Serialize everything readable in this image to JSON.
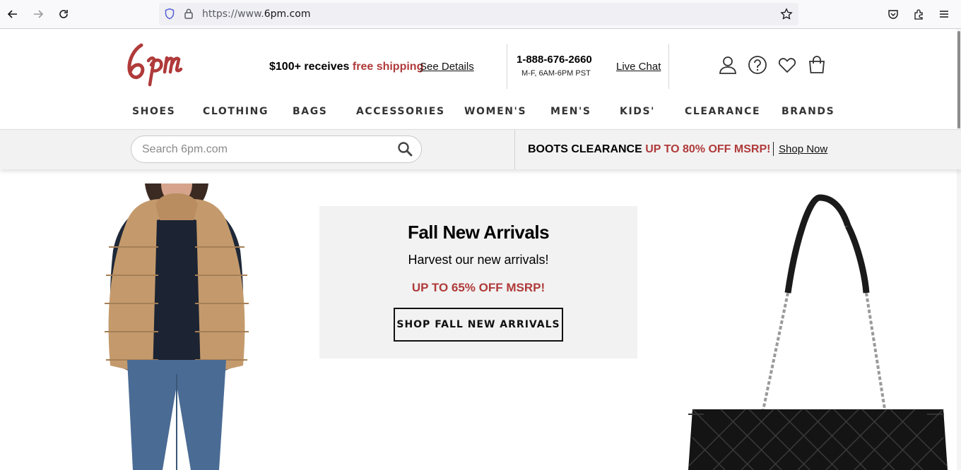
{
  "browser": {
    "url_prefix": "https://www.",
    "url_domain": "6pm.com"
  },
  "header": {
    "logo_text": "6pm",
    "shipping_prefix": "$100+ receives ",
    "shipping_highlight": "free shipping",
    "see_details": "See Details",
    "phone": "1-888-676-2660",
    "hours": "M-F, 6AM-6PM PST",
    "live_chat": "Live Chat"
  },
  "nav": {
    "items": [
      "SHOES",
      "CLOTHING",
      "BAGS",
      "ACCESSORIES",
      "WOMEN'S",
      "MEN'S",
      "KIDS'",
      "CLEARANCE",
      "BRANDS"
    ]
  },
  "search": {
    "placeholder": "Search 6pm.com"
  },
  "banner": {
    "boots_label": "BOOTS CLEARANCE ",
    "boots_offer": "UP TO 80% OFF MSRP!",
    "shop_now": "Shop Now"
  },
  "hero": {
    "title": "Fall New Arrivals",
    "subtitle": "Harvest our new arrivals!",
    "offer": "UP TO 65% OFF MSRP!",
    "cta": "SHOP FALL NEW ARRIVALS"
  },
  "colors": {
    "brand_red": "#b03a3a",
    "text": "#111111",
    "band_bg": "#f2f2f2"
  }
}
